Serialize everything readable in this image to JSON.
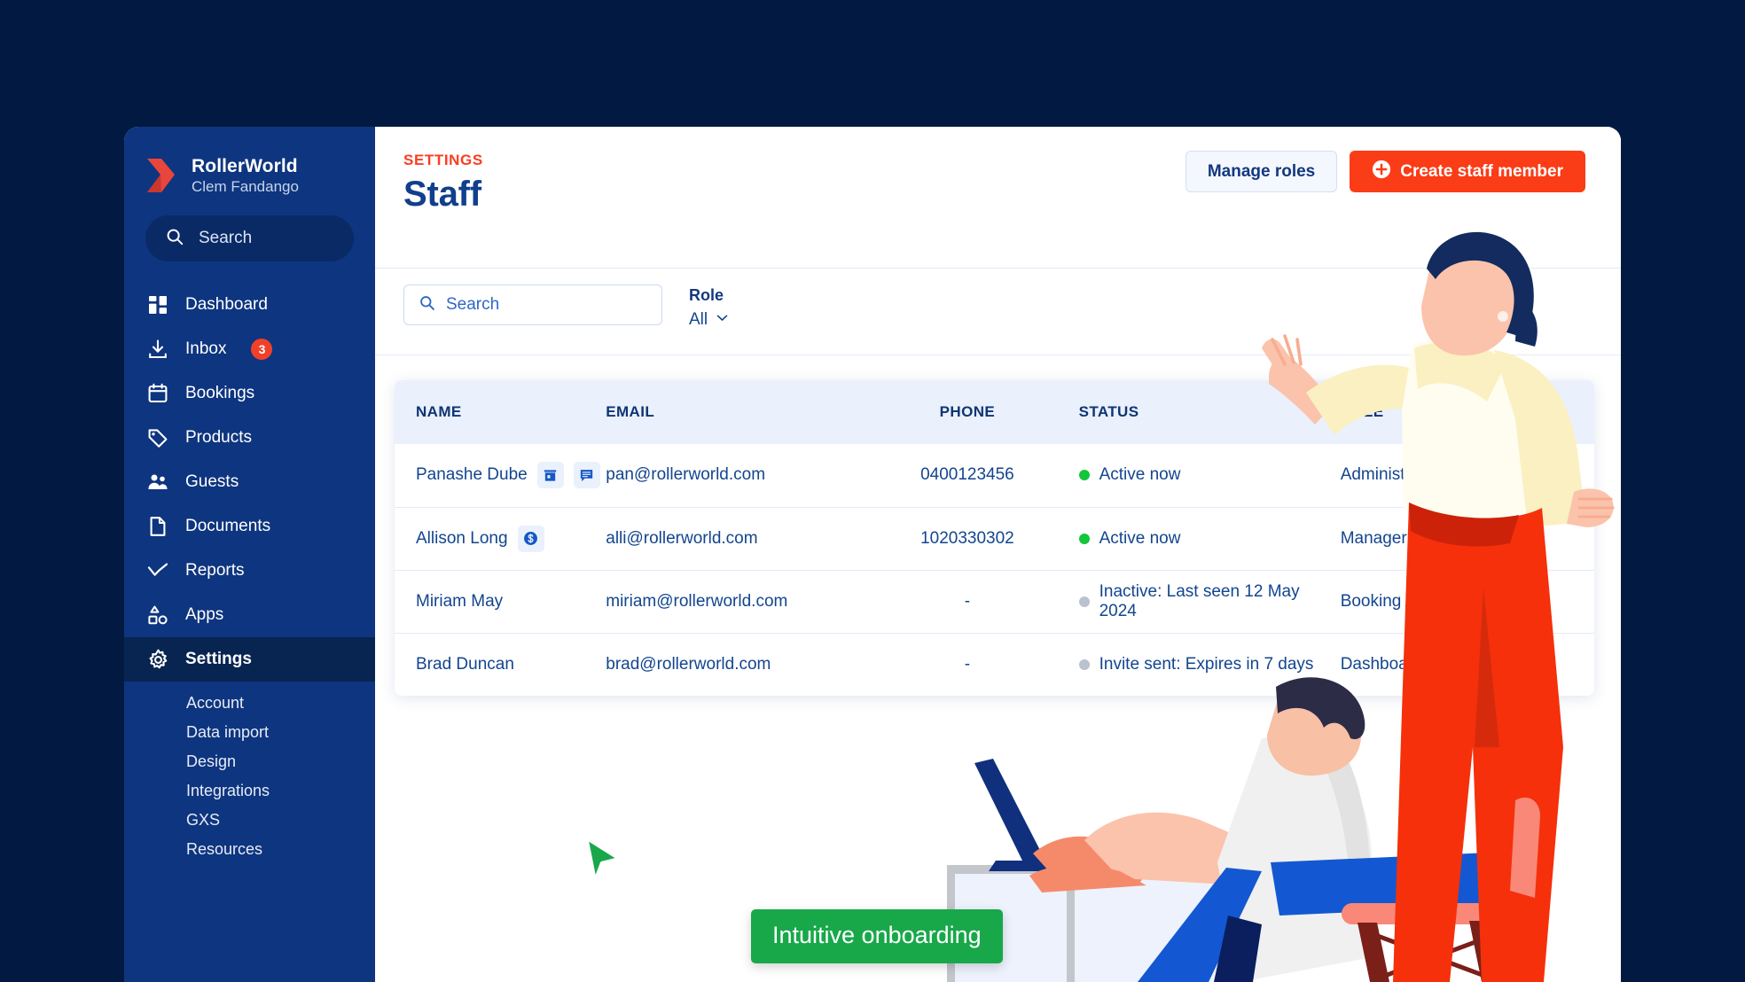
{
  "brand": {
    "name": "RollerWorld",
    "account": "Clem Fandango",
    "logo_icon": "chevron-logo-icon",
    "logo_color": "#e8453c"
  },
  "sidebar": {
    "search": {
      "placeholder": "Search",
      "icon": "search-icon"
    },
    "items": [
      {
        "label": "Dashboard",
        "icon": "dashboard-icon",
        "badge": null,
        "active": false
      },
      {
        "label": "Inbox",
        "icon": "inbox-download-icon",
        "badge": "3",
        "active": false
      },
      {
        "label": "Bookings",
        "icon": "calendar-icon",
        "badge": null,
        "active": false
      },
      {
        "label": "Products",
        "icon": "tag-icon",
        "badge": null,
        "active": false
      },
      {
        "label": "Guests",
        "icon": "people-icon",
        "badge": null,
        "active": false
      },
      {
        "label": "Documents",
        "icon": "document-icon",
        "badge": null,
        "active": false
      },
      {
        "label": "Reports",
        "icon": "trend-line-icon",
        "badge": null,
        "active": false
      },
      {
        "label": "Apps",
        "icon": "shapes-apps-icon",
        "badge": null,
        "active": false
      },
      {
        "label": "Settings",
        "icon": "gear-icon",
        "badge": null,
        "active": true
      }
    ],
    "sub_items": [
      {
        "label": "Account"
      },
      {
        "label": "Data import"
      },
      {
        "label": "Design"
      },
      {
        "label": "Integrations"
      },
      {
        "label": "GXS"
      },
      {
        "label": "Resources"
      }
    ]
  },
  "header": {
    "eyebrow": "SETTINGS",
    "title": "Staff",
    "manage_roles_label": "Manage roles",
    "create_staff_label": "Create staff member",
    "create_staff_icon": "plus-circle-icon"
  },
  "filters": {
    "search_placeholder": "Search",
    "search_value": "",
    "search_icon": "search-icon",
    "role_label": "Role",
    "role_value": "All",
    "role_chevron_icon": "chevron-down-icon"
  },
  "table": {
    "columns": [
      "NAME",
      "EMAIL",
      "PHONE",
      "STATUS",
      "ROLE",
      "ROLE"
    ],
    "rows": [
      {
        "name": "Panashe Dube",
        "chips": [
          "store-icon",
          "chat-icon"
        ],
        "email": "pan@rollerworld.com",
        "phone": "0400123456",
        "status": "Active now",
        "status_state": "online",
        "role": "Administrator",
        "role_icons": [
          "person-icon",
          "check-icon"
        ]
      },
      {
        "name": "Allison Long",
        "chips": [
          "dollar-icon"
        ],
        "email": "alli@rollerworld.com",
        "phone": "1020330302",
        "status": "Active now",
        "status_state": "online",
        "role": "Manager",
        "role_icons": []
      },
      {
        "name": "Miriam May",
        "chips": [],
        "email": "miriam@rollerworld.com",
        "phone": "-",
        "status": "Inactive: Last seen 12 May 2024",
        "status_state": "offline",
        "role": "Booking Agent",
        "role_icons": [
          "check-icon"
        ]
      },
      {
        "name": "Brad Duncan",
        "chips": [],
        "email": "brad@rollerworld.com",
        "phone": "-",
        "status": "Invite sent: Expires in 7 days",
        "status_state": "offline",
        "role": "Dashboard",
        "role_icons": []
      }
    ]
  },
  "annotation": {
    "tooltip_text": "Intuitive onboarding",
    "tooltip_color": "#18a84a",
    "cursor_icon": "cursor-arrow-icon",
    "cursor_color": "#18a84a"
  },
  "theme": {
    "page_background": "#021a41",
    "sidebar": "#0e357f",
    "sidebar_active": "#082451",
    "accent_red": "#fa3c17",
    "brand_blue": "#13387f",
    "content_background": "#eef2fd"
  }
}
